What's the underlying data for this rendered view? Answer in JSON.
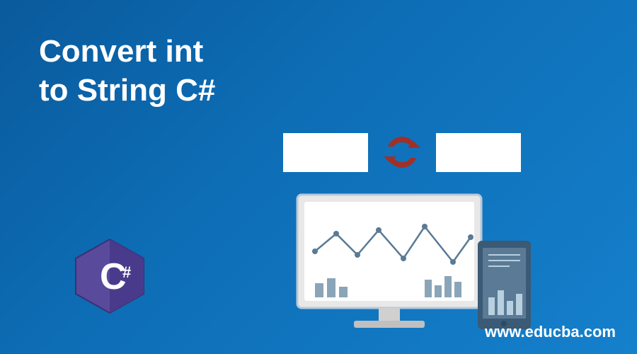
{
  "title_line1": "Convert int",
  "title_line2": "to String C#",
  "url": "www.educba.com",
  "icons": {
    "csharp": "csharp-logo",
    "refresh": "refresh-arrows",
    "computer": "monitor-with-chart"
  }
}
